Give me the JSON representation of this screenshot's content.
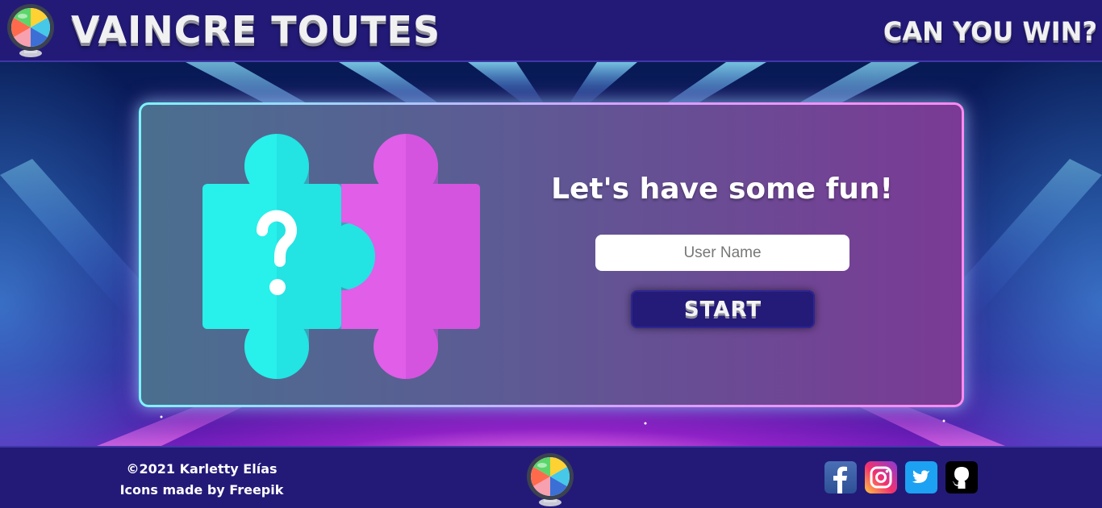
{
  "header": {
    "title": "VAINCRE TOUTES",
    "tagline": "CAN YOU WIN?",
    "logo_icon": "color-wheel-globe-icon"
  },
  "main": {
    "illustration_icon": "puzzle-question-icon",
    "headline": "Let's have some fun!",
    "username_placeholder": "User Name",
    "username_value": "",
    "start_label": "START"
  },
  "footer": {
    "copyright": "©2021 Karletty Elías",
    "icons_credit": "Icons made by Freepik",
    "logo_icon": "color-wheel-globe-icon",
    "social_links": [
      {
        "name": "facebook-icon",
        "color": "#3b5998"
      },
      {
        "name": "instagram-icon",
        "color": "#c13584"
      },
      {
        "name": "twitter-icon",
        "color": "#1da1f2"
      },
      {
        "name": "github-icon",
        "color": "#000000"
      }
    ]
  },
  "colors": {
    "bar_bg": "#231a78",
    "puzzle_cyan": "#28f0ea",
    "puzzle_magenta": "#e05ee8",
    "button_bg": "#241a78"
  }
}
